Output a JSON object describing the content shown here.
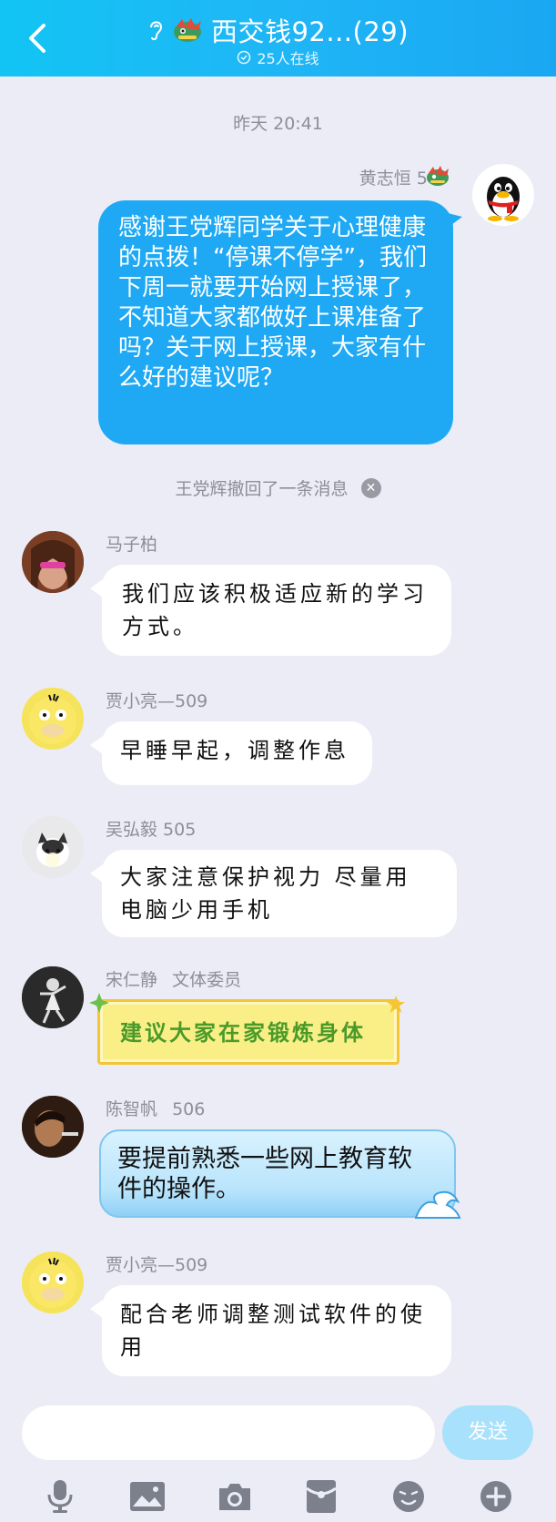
{
  "header": {
    "title": "西交钱92...(29)",
    "online": "25人在线"
  },
  "timestamp": "昨天 20:41",
  "messages": {
    "m1": {
      "sender": "黄志恒 507",
      "text": "感谢王党辉同学关于心理健康的点拨！“停课不停学”，我们下周一就要开始网上授课了，不知道大家都做好上课准备了吗？关于网上授课，大家有什么好的建议呢？"
    },
    "recall": "王党辉撤回了一条消息",
    "m2": {
      "sender": "马子柏",
      "line1": "我们应该积极适应新的学习",
      "line2": "方式。"
    },
    "m3": {
      "sender": "贾小亮—509",
      "line1": "早睡早起，调整作息"
    },
    "m4": {
      "sender": "吴弘毅 505",
      "line1": "大家注意保护视力 尽量用",
      "line2": "电脑少用手机"
    },
    "m5": {
      "sender": "宋仁静",
      "tag": "文体委员",
      "line1": "建议大家在家锻炼身体"
    },
    "m6": {
      "sender": "陈智帆",
      "tag": "506",
      "line1": "要提前熟悉一些网上教育软",
      "line2": "件的操作。"
    },
    "m7": {
      "sender": "贾小亮—509",
      "line1": "配合老师调整测试软件的使",
      "line2": "用"
    }
  },
  "input": {
    "placeholder": "",
    "send_label": "发送"
  },
  "toolbar": [
    "microphone-icon",
    "image-icon",
    "camera-icon",
    "red-packet-icon",
    "emoji-icon",
    "plus-icon"
  ],
  "colors": {
    "header": "#1fb6f6",
    "my_bubble": "#1fa9f4",
    "background": "#ececf6",
    "send": "#a8e1fb"
  }
}
